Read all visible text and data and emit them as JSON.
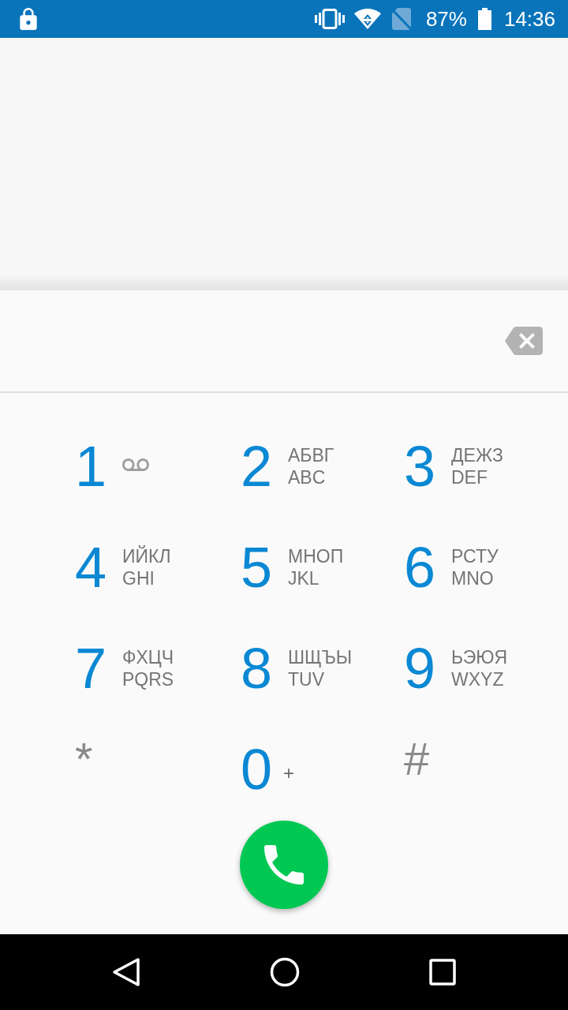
{
  "status_bar": {
    "battery": "87%",
    "time": "14:36"
  },
  "dialpad": {
    "keys": [
      {
        "kind": "voicemail",
        "digit": "1"
      },
      {
        "kind": "letters",
        "digit": "2",
        "letters": [
          "АБВГ",
          "ABC"
        ]
      },
      {
        "kind": "letters",
        "digit": "3",
        "letters": [
          "ДЕЖЗ",
          "DEF"
        ]
      },
      {
        "kind": "letters",
        "digit": "4",
        "letters": [
          "ИЙКЛ",
          "GHI"
        ]
      },
      {
        "kind": "letters",
        "digit": "5",
        "letters": [
          "МНОП",
          "JKL"
        ]
      },
      {
        "kind": "letters",
        "digit": "6",
        "letters": [
          "РСТУ",
          "MNO"
        ]
      },
      {
        "kind": "letters",
        "digit": "7",
        "letters": [
          "ФХЦЧ",
          "PQRS"
        ]
      },
      {
        "kind": "letters",
        "digit": "8",
        "letters": [
          "ШЩЪЫ",
          "TUV"
        ]
      },
      {
        "kind": "letters",
        "digit": "9",
        "letters": [
          "ЬЭЮЯ",
          "WXYZ"
        ]
      },
      {
        "kind": "symbol",
        "digit": "*"
      },
      {
        "kind": "plus",
        "digit": "0",
        "sub": "+"
      },
      {
        "kind": "symbol",
        "digit": "#"
      }
    ]
  }
}
